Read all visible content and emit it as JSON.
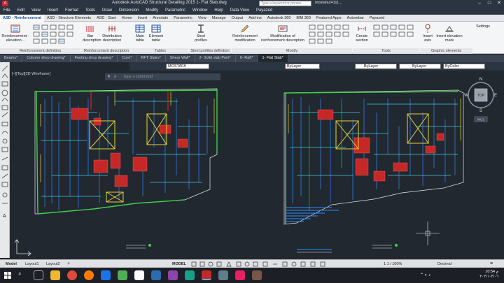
{
  "titlebar": {
    "title": "Autodesk AutoCAD Structural Detailing 2015    1- Flat Slab.dwg",
    "search_placeholder": "Type a keyword or phrase",
    "user": "mostafa24111...",
    "minimize": "–",
    "maximize": "□",
    "close": "✕"
  },
  "menubar": [
    "File",
    "Edit",
    "View",
    "Insert",
    "Format",
    "Tools",
    "Draw",
    "Dimension",
    "Modify",
    "Parametric",
    "Window",
    "Help",
    "Data View",
    "Payazed"
  ],
  "ribbon_tabs": [
    "ASD - Reinforcement",
    "ASD - Structure Elements",
    "ASD - Start",
    "Home",
    "Insert",
    "Annotate",
    "Parametric",
    "View",
    "Manage",
    "Output",
    "Add-ins",
    "Autodesk 360",
    "BIM 360",
    "Featured Apps",
    "Autorebar",
    "Payazed"
  ],
  "ribbon": {
    "buttons": [
      "Reinforcement - elevation...",
      "Bar description",
      "Distribution description",
      "Main table",
      "Element table",
      "Steel profiles",
      "Reinforcement modification",
      "Modification of reinforcement description",
      "Create section",
      "Insert axis",
      "Insert elevation mark",
      "Settings"
    ],
    "groups": [
      "Reinforcement definition",
      "Reinforcement description",
      "Tables",
      "Steel profiles definition",
      "Modify",
      "Tools",
      "Graphic elements"
    ]
  },
  "file_tabs": [
    "Beams*",
    "Column shop drawing*",
    "Footing shop drawing*",
    "Core*",
    "RFT Stairs*",
    "Shear Wall*",
    "2- Solid slab Print*",
    "0- Raft*",
    "1- Flat Slab*"
  ],
  "properties": {
    "layer": "MOSTAFA",
    "color": "ByLayer",
    "linetype": "ByLayer",
    "lineweight": "ByLayer",
    "plotstyle": "ByColor"
  },
  "command_placeholder": "Type a command",
  "viewport_label": "[–][Top][2D Wireframe]",
  "viewcube": {
    "top": "TOP",
    "n": "N",
    "s": "S",
    "w": "W",
    "e": "E",
    "wcs": "WCS"
  },
  "status": {
    "tabs": [
      "Model",
      "Layout1",
      "Layout2"
    ],
    "mode": "MODEL",
    "scale": "1:1 / 100%",
    "units": "Decimal"
  },
  "taskbar": {
    "time": "10:54 م",
    "date": "٢٠٢١/٠٢/٠٦"
  },
  "colors": {
    "canvas": "#212830",
    "wall": "#3fd14a",
    "column": "#c62828",
    "rebar_blue": "#2d8cff",
    "rebar_cyan": "#40c8e0",
    "rebar_yellow": "#e8d23a",
    "outline": "#e8e8e8",
    "accent": "#1a4fa0"
  }
}
